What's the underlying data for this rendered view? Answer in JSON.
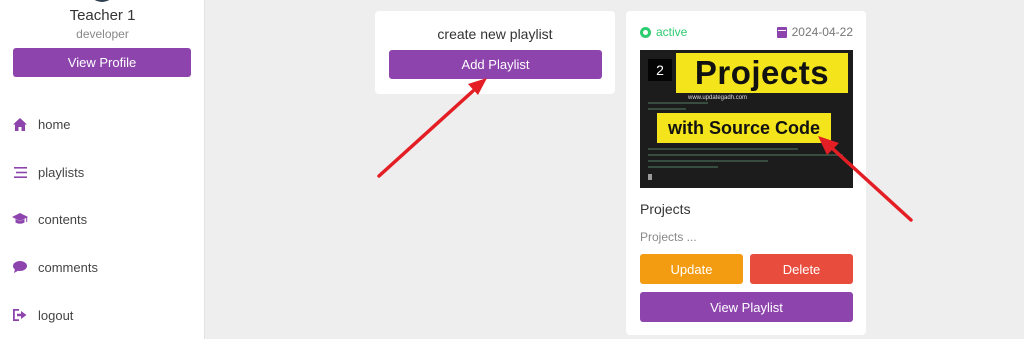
{
  "sidebar": {
    "teacher_name": "Teacher 1",
    "teacher_role": "developer",
    "view_profile_label": "View Profile",
    "nav": [
      {
        "label": "home",
        "icon": "home-icon"
      },
      {
        "label": "playlists",
        "icon": "list-icon"
      },
      {
        "label": "contents",
        "icon": "graduation-cap-icon"
      },
      {
        "label": "comments",
        "icon": "comment-icon"
      },
      {
        "label": "logout",
        "icon": "logout-icon"
      }
    ]
  },
  "create_card": {
    "title": "create new playlist",
    "add_label": "Add Playlist"
  },
  "playlist_card": {
    "status": "active",
    "date": "2024-04-22",
    "thumbnail": {
      "count": "2",
      "headline": "Projects",
      "url": "www.updategadh.com",
      "subheadline": "with Source Code"
    },
    "title": "Projects",
    "description": "Projects ...",
    "update_label": "Update",
    "delete_label": "Delete",
    "view_label": "View Playlist"
  },
  "colors": {
    "primary": "#8e44ad",
    "update": "#f39c12",
    "delete": "#e74c3c",
    "active": "#2ecc71",
    "annotation_arrow": "#e31e24"
  }
}
